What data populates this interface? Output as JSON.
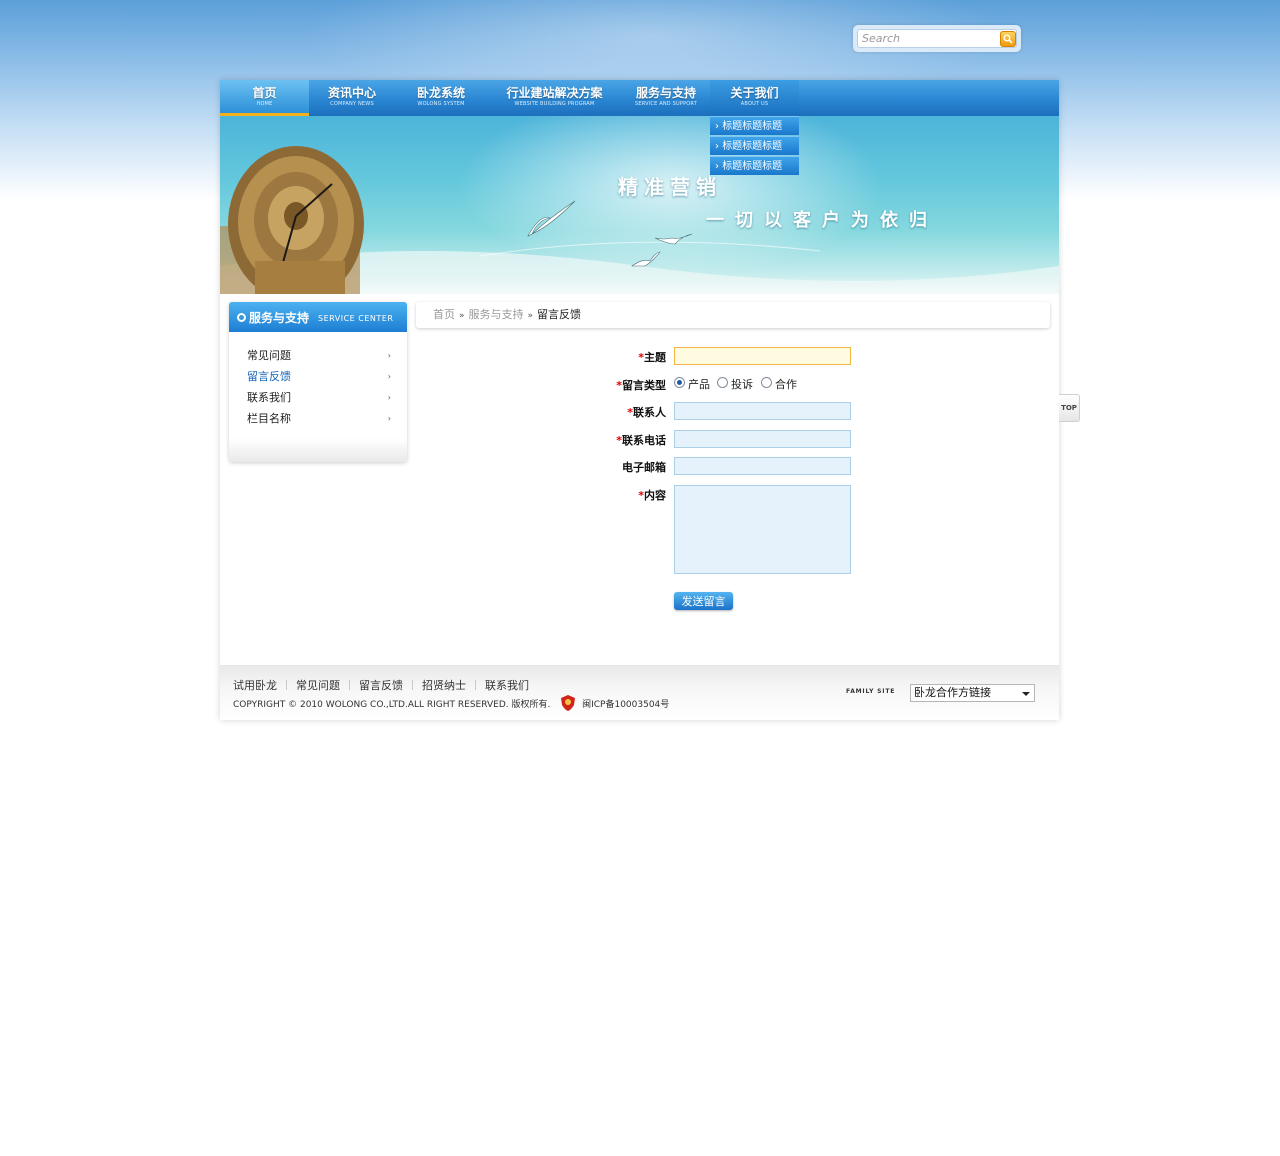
{
  "search": {
    "placeholder": "Search"
  },
  "nav": [
    {
      "cn": "首页",
      "en": "HOME"
    },
    {
      "cn": "资讯中心",
      "en": "COMPANY NEWS"
    },
    {
      "cn": "卧龙系统",
      "en": "WOLONG SYSTEM"
    },
    {
      "cn": "行业建站解决方案",
      "en": "WEBSITE BUILDING PROGRAM"
    },
    {
      "cn": "服务与支持",
      "en": "SERVICE AND SUPPORT"
    },
    {
      "cn": "关于我们",
      "en": "ABOUT US"
    }
  ],
  "dropdown": [
    "标题标题标题",
    "标题标题标题",
    "标题标题标题"
  ],
  "banner": {
    "slogan1": "精准营销",
    "slogan2": "一切以客户为依归"
  },
  "sidebar": {
    "title": "服务与支持",
    "subtitle": "SERVICE CENTER",
    "items": [
      "常见问题",
      "留言反馈",
      "联系我们",
      "栏目名称"
    ],
    "active_index": 1
  },
  "breadcrumb": {
    "home": "首页",
    "section": "服务与支持",
    "current": "留言反馈",
    "separator": "»"
  },
  "form": {
    "subject_label": "主题",
    "type_label": "留言类型",
    "type_options": [
      "产品",
      "投诉",
      "合作"
    ],
    "type_selected": "产品",
    "contact_label": "联系人",
    "phone_label": "联系电话",
    "email_label": "电子邮箱",
    "content_label": "内容",
    "required_mark": "*",
    "submit_label": "发送留言"
  },
  "footer": {
    "links": [
      "试用卧龙",
      "常见问题",
      "留言反馈",
      "招贤纳士",
      "联系我们"
    ],
    "copyright": "COPYRIGHT © 2010 WOLONG CO.,LTD.ALL RIGHT RESERVED. 版权所有.",
    "icp": "闽ICP备10003504号",
    "family_site_label": "FAMILY SITE",
    "family_site_value": "卧龙合作方链接"
  },
  "top_button": "TOP",
  "colors": {
    "nav_blue": "#2a86d2",
    "active_underline": "#f2b21c",
    "required": "#e00000",
    "link_active": "#1463b3"
  }
}
